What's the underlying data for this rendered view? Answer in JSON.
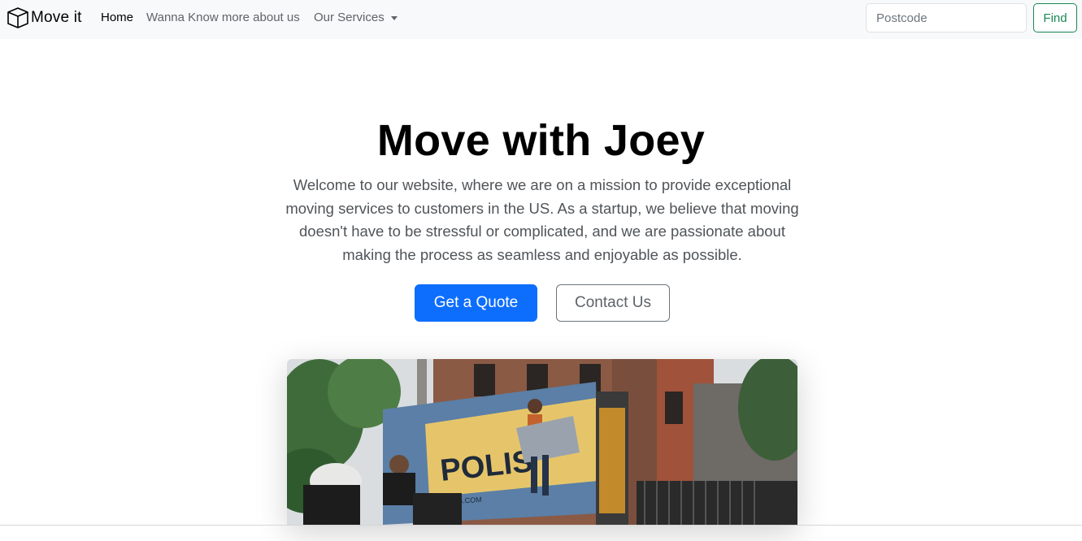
{
  "navbar": {
    "brand": {
      "text": "Move it",
      "icon": "box-icon"
    },
    "links": [
      {
        "label": "Home",
        "active": true
      },
      {
        "label": "Wanna Know more about us",
        "active": false
      },
      {
        "label": "Our Services",
        "active": false,
        "dropdown": true
      }
    ],
    "search": {
      "placeholder": "Postcode",
      "value": ""
    },
    "find_label": "Find"
  },
  "hero": {
    "title": "Move with Joey",
    "lead": "Welcome to our website, where we are on a mission to provide exceptional moving services to customers in the US. As a startup, we believe that moving doesn't have to be stressful or complicated, and we are passionate about making the process as seamless and enjoyable as possible.",
    "primary_button": "Get a Quote",
    "secondary_button": "Contact Us"
  },
  "image": {
    "truck_text": "POLIS",
    "truck_url": "MOVING.COM"
  },
  "colors": {
    "primary": "#0d6efd",
    "success": "#198754",
    "navbar_bg": "#f8f9fa"
  }
}
